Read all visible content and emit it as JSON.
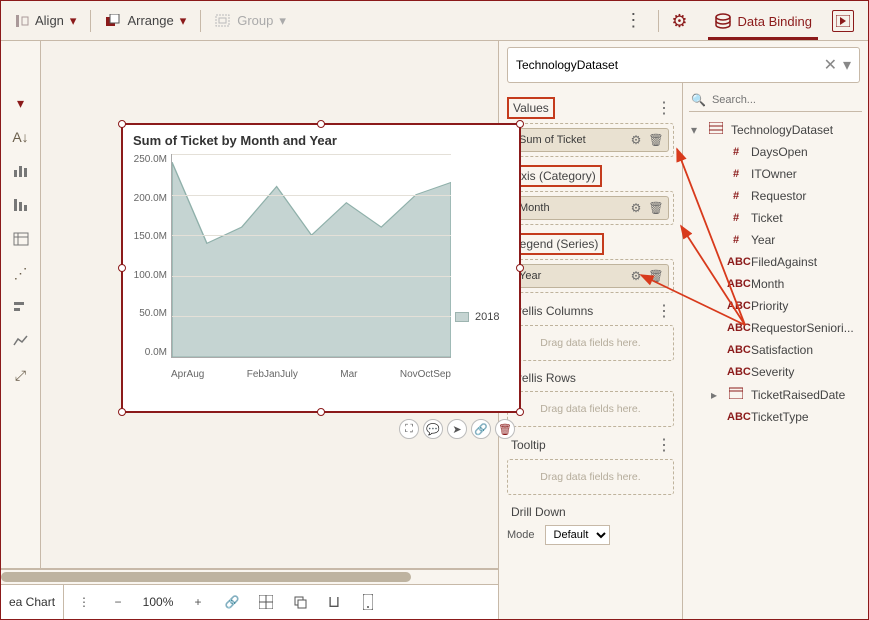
{
  "toolbar": {
    "align_label": "Align",
    "arrange_label": "Arrange",
    "group_label": "Group",
    "data_binding_label": "Data Binding"
  },
  "dataset": {
    "name": "TechnologyDataset"
  },
  "chart_title": "Sum of Ticket by Month and Year",
  "legend_label": "2018",
  "chart_data": {
    "type": "area",
    "title": "Sum of Ticket by Month and Year",
    "xlabel": "",
    "ylabel": "",
    "ylim": [
      0,
      250000000
    ],
    "y_ticks": [
      "250.0M",
      "200.0M",
      "150.0M",
      "100.0M",
      "50.0M",
      "0.0M"
    ],
    "categories": [
      "Apr",
      "Aug",
      "Feb",
      "Jan",
      "July",
      "Mar",
      "Nov",
      "Oct",
      "Sep"
    ],
    "x_tick_labels": [
      "AprAug",
      "FebJanJuly",
      "Mar",
      "NovOctSep"
    ],
    "series": [
      {
        "name": "2018",
        "values": [
          240000000,
          140000000,
          160000000,
          210000000,
          150000000,
          190000000,
          160000000,
          200000000,
          215000000
        ]
      }
    ]
  },
  "sections": {
    "values": {
      "title": "Values",
      "pill": "Sum of Ticket"
    },
    "axis": {
      "title": "Axis (Category)",
      "pill": "Month"
    },
    "legend": {
      "title": "Legend (Series)",
      "pill": "Year"
    },
    "trellis_cols": {
      "title": "Trellis Columns",
      "placeholder": "Drag data fields here."
    },
    "trellis_rows": {
      "title": "Trellis Rows",
      "placeholder": "Drag data fields here."
    },
    "tooltip": {
      "title": "Tooltip",
      "placeholder": "Drag data fields here."
    },
    "drill": {
      "title": "Drill Down",
      "mode_label": "Mode",
      "mode_value": "Default"
    }
  },
  "fields": {
    "search_placeholder": "Search...",
    "root": "TechnologyDataset",
    "items": [
      {
        "type": "#",
        "name": "DaysOpen"
      },
      {
        "type": "#",
        "name": "ITOwner"
      },
      {
        "type": "#",
        "name": "Requestor"
      },
      {
        "type": "#",
        "name": "Ticket"
      },
      {
        "type": "#",
        "name": "Year"
      },
      {
        "type": "ABC",
        "name": "FiledAgainst"
      },
      {
        "type": "ABC",
        "name": "Month"
      },
      {
        "type": "ABC",
        "name": "Priority"
      },
      {
        "type": "ABC",
        "name": "RequestorSeniori..."
      },
      {
        "type": "ABC",
        "name": "Satisfaction"
      },
      {
        "type": "ABC",
        "name": "Severity"
      },
      {
        "type": "date",
        "name": "TicketRaisedDate"
      },
      {
        "type": "ABC",
        "name": "TicketType"
      }
    ]
  },
  "bottom": {
    "chart_type": "ea Chart",
    "zoom": "100%"
  }
}
